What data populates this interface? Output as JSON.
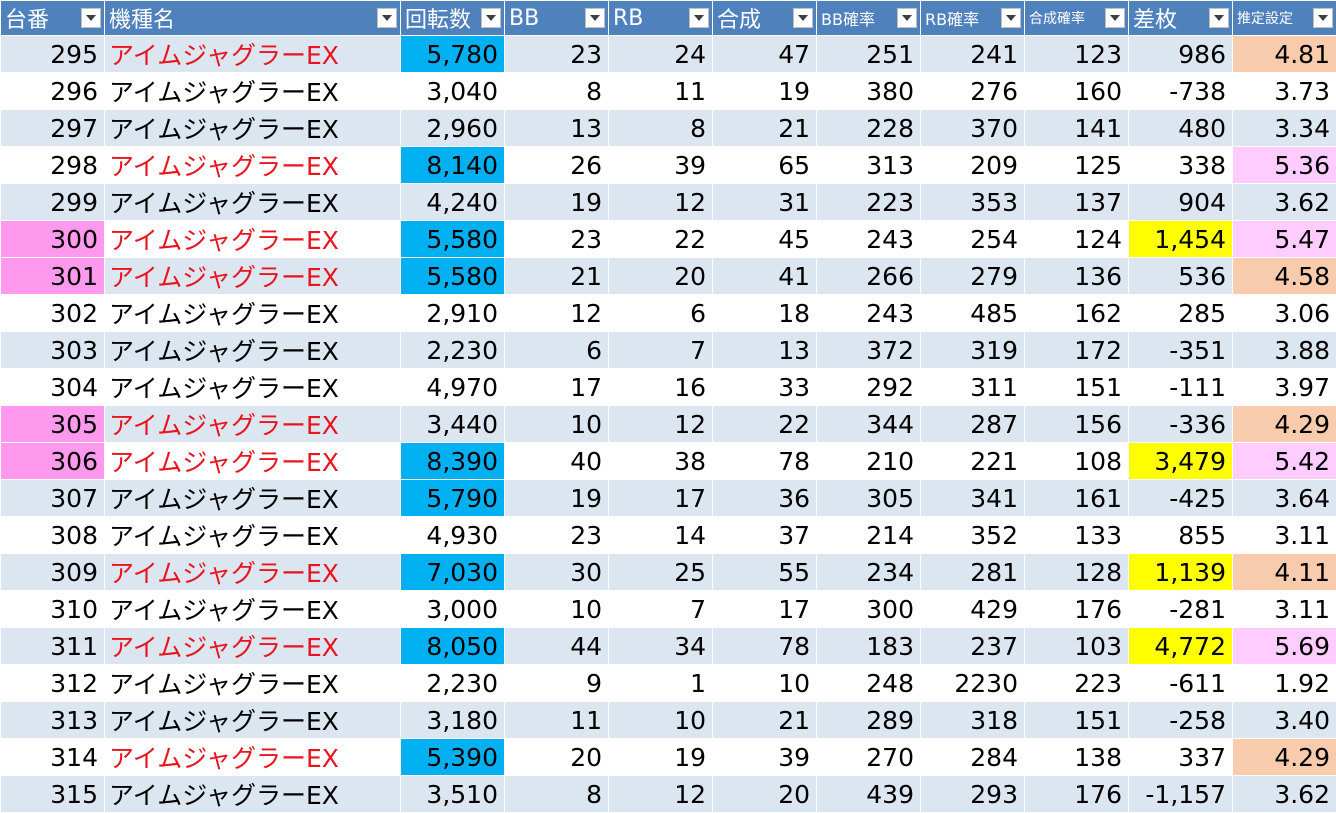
{
  "table": {
    "headers": [
      "台番",
      "機種名",
      "回転数",
      "BB",
      "RB",
      "合成",
      "BB確率",
      "RB確率",
      "合成確率",
      "差枚",
      "推定設定"
    ],
    "rows": [
      {
        "cells": [
          "295",
          "アイムジャグラーEX",
          "5,780",
          "23",
          "24",
          "47",
          "251",
          "241",
          "123",
          "986",
          "4.81"
        ],
        "highlight": true,
        "fills": {
          "2": "blue",
          "10": "peach"
        }
      },
      {
        "cells": [
          "296",
          "アイムジャグラーEX",
          "3,040",
          "8",
          "11",
          "19",
          "380",
          "276",
          "160",
          "-738",
          "3.73"
        ],
        "highlight": false,
        "fills": {}
      },
      {
        "cells": [
          "297",
          "アイムジャグラーEX",
          "2,960",
          "13",
          "8",
          "21",
          "228",
          "370",
          "141",
          "480",
          "3.34"
        ],
        "highlight": false,
        "fills": {}
      },
      {
        "cells": [
          "298",
          "アイムジャグラーEX",
          "8,140",
          "26",
          "39",
          "65",
          "313",
          "209",
          "125",
          "338",
          "5.36"
        ],
        "highlight": true,
        "fills": {
          "2": "blue",
          "10": "lpink"
        }
      },
      {
        "cells": [
          "299",
          "アイムジャグラーEX",
          "4,240",
          "19",
          "12",
          "31",
          "223",
          "353",
          "137",
          "904",
          "3.62"
        ],
        "highlight": false,
        "fills": {}
      },
      {
        "cells": [
          "300",
          "アイムジャグラーEX",
          "5,580",
          "23",
          "22",
          "45",
          "243",
          "254",
          "124",
          "1,454",
          "5.47"
        ],
        "highlight": true,
        "fills": {
          "0": "pink",
          "2": "blue",
          "9": "yellow",
          "10": "lpink"
        }
      },
      {
        "cells": [
          "301",
          "アイムジャグラーEX",
          "5,580",
          "21",
          "20",
          "41",
          "266",
          "279",
          "136",
          "536",
          "4.58"
        ],
        "highlight": true,
        "fills": {
          "0": "pink",
          "2": "blue",
          "10": "peach"
        }
      },
      {
        "cells": [
          "302",
          "アイムジャグラーEX",
          "2,910",
          "12",
          "6",
          "18",
          "243",
          "485",
          "162",
          "285",
          "3.06"
        ],
        "highlight": false,
        "fills": {}
      },
      {
        "cells": [
          "303",
          "アイムジャグラーEX",
          "2,230",
          "6",
          "7",
          "13",
          "372",
          "319",
          "172",
          "-351",
          "3.88"
        ],
        "highlight": false,
        "fills": {}
      },
      {
        "cells": [
          "304",
          "アイムジャグラーEX",
          "4,970",
          "17",
          "16",
          "33",
          "292",
          "311",
          "151",
          "-111",
          "3.97"
        ],
        "highlight": false,
        "fills": {}
      },
      {
        "cells": [
          "305",
          "アイムジャグラーEX",
          "3,440",
          "10",
          "12",
          "22",
          "344",
          "287",
          "156",
          "-336",
          "4.29"
        ],
        "highlight": true,
        "fills": {
          "0": "pink",
          "10": "peach"
        }
      },
      {
        "cells": [
          "306",
          "アイムジャグラーEX",
          "8,390",
          "40",
          "38",
          "78",
          "210",
          "221",
          "108",
          "3,479",
          "5.42"
        ],
        "highlight": true,
        "fills": {
          "0": "pink",
          "2": "blue",
          "9": "yellow",
          "10": "lpink"
        }
      },
      {
        "cells": [
          "307",
          "アイムジャグラーEX",
          "5,790",
          "19",
          "17",
          "36",
          "305",
          "341",
          "161",
          "-425",
          "3.64"
        ],
        "highlight": false,
        "fills": {
          "2": "blue"
        }
      },
      {
        "cells": [
          "308",
          "アイムジャグラーEX",
          "4,930",
          "23",
          "14",
          "37",
          "214",
          "352",
          "133",
          "855",
          "3.11"
        ],
        "highlight": false,
        "fills": {}
      },
      {
        "cells": [
          "309",
          "アイムジャグラーEX",
          "7,030",
          "30",
          "25",
          "55",
          "234",
          "281",
          "128",
          "1,139",
          "4.11"
        ],
        "highlight": true,
        "fills": {
          "2": "blue",
          "9": "yellow",
          "10": "peach"
        }
      },
      {
        "cells": [
          "310",
          "アイムジャグラーEX",
          "3,000",
          "10",
          "7",
          "17",
          "300",
          "429",
          "176",
          "-281",
          "3.11"
        ],
        "highlight": false,
        "fills": {}
      },
      {
        "cells": [
          "311",
          "アイムジャグラーEX",
          "8,050",
          "44",
          "34",
          "78",
          "183",
          "237",
          "103",
          "4,772",
          "5.69"
        ],
        "highlight": true,
        "fills": {
          "2": "blue",
          "9": "yellow",
          "10": "lpink"
        }
      },
      {
        "cells": [
          "312",
          "アイムジャグラーEX",
          "2,230",
          "9",
          "1",
          "10",
          "248",
          "2230",
          "223",
          "-611",
          "1.92"
        ],
        "highlight": false,
        "fills": {}
      },
      {
        "cells": [
          "313",
          "アイムジャグラーEX",
          "3,180",
          "11",
          "10",
          "21",
          "289",
          "318",
          "151",
          "-258",
          "3.40"
        ],
        "highlight": false,
        "fills": {}
      },
      {
        "cells": [
          "314",
          "アイムジャグラーEX",
          "5,390",
          "20",
          "19",
          "39",
          "270",
          "284",
          "138",
          "337",
          "4.29"
        ],
        "highlight": true,
        "fills": {
          "2": "blue",
          "10": "peach"
        }
      },
      {
        "cells": [
          "315",
          "アイムジャグラーEX",
          "3,510",
          "8",
          "12",
          "20",
          "439",
          "293",
          "176",
          "-1,157",
          "3.62"
        ],
        "highlight": false,
        "fills": {}
      }
    ]
  },
  "colors": {
    "header_bg": "#4f81bd",
    "band": "#dce6f1",
    "highlight_text": "#e8141e",
    "pink": "#ff99ee",
    "blue": "#00b0f0",
    "yellow": "#ffff00",
    "peach": "#f8cbad",
    "lpink": "#ffccff"
  },
  "icons": {
    "filter": "dropdown-arrow-icon"
  }
}
